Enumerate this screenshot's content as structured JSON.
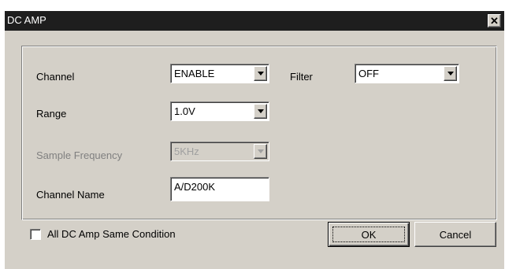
{
  "window": {
    "title": "DC AMP",
    "close_glyph": "✕"
  },
  "form": {
    "channel": {
      "label": "Channel",
      "value": "ENABLE"
    },
    "filter": {
      "label": "Filter",
      "value": "OFF"
    },
    "range": {
      "label": "Range",
      "value": "1.0V"
    },
    "sample_frequency": {
      "label": "Sample Frequency",
      "value": "5KHz",
      "enabled": false
    },
    "channel_name": {
      "label": "Channel Name",
      "value": "A/D200K"
    }
  },
  "footer": {
    "same_condition": {
      "label": "All DC Amp Same Condition",
      "checked": false
    },
    "ok_label": "OK",
    "cancel_label": "Cancel"
  },
  "colors": {
    "dialog_bg": "#d4d0c8",
    "titlebar_bg": "#1e1e1e",
    "disabled_text": "#808080"
  }
}
